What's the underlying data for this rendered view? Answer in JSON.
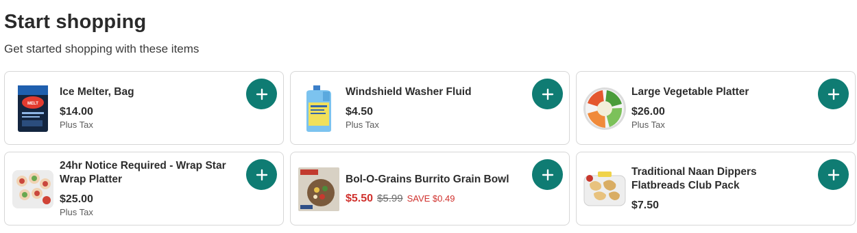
{
  "section": {
    "title": "Start shopping",
    "subtitle": "Get started shopping with these items"
  },
  "products": [
    {
      "name": "Ice Melter, Bag",
      "price": "$14.00",
      "tax_note": "Plus Tax",
      "image_icon": "ice-melter-bag-icon"
    },
    {
      "name": "Windshield Washer Fluid",
      "price": "$4.50",
      "tax_note": "Plus Tax",
      "image_icon": "washer-fluid-jug-icon"
    },
    {
      "name": "Large Vegetable Platter",
      "price": "$26.00",
      "tax_note": "Plus Tax",
      "image_icon": "vegetable-platter-icon"
    },
    {
      "name": "24hr Notice Required - Wrap Star Wrap Platter",
      "price": "$25.00",
      "tax_note": "Plus Tax",
      "image_icon": "wrap-platter-icon"
    },
    {
      "name": "Bol-O-Grains Burrito Grain Bowl",
      "sale_price": "$5.50",
      "original_price": "$5.99",
      "savings": "SAVE $0.49",
      "image_icon": "grain-bowl-box-icon"
    },
    {
      "name": "Traditional Naan Dippers Flatbreads Club Pack",
      "price": "$7.50",
      "image_icon": "naan-pack-icon"
    }
  ],
  "colors": {
    "add_button": "#0f7c73",
    "sale": "#d0312d"
  },
  "icons": {
    "add": "plus-icon"
  }
}
